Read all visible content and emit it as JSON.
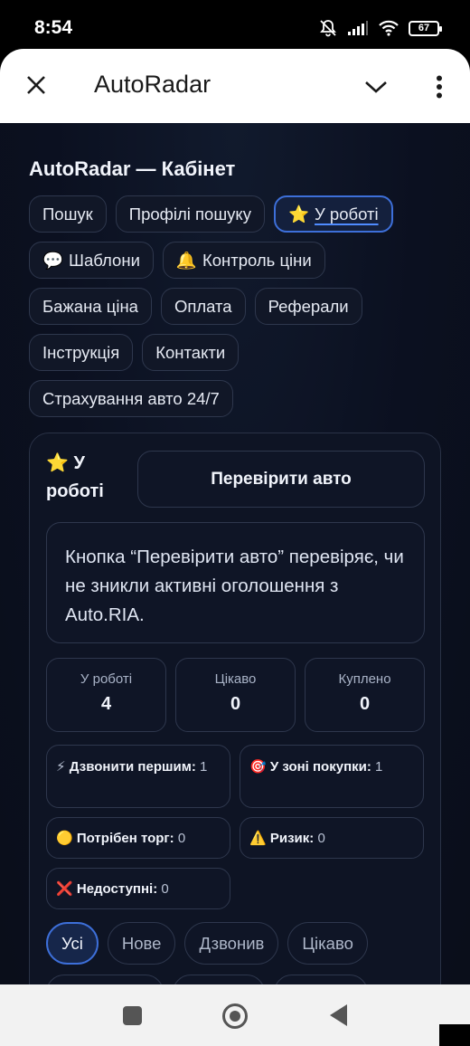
{
  "status_bar": {
    "time": "8:54",
    "battery": "67"
  },
  "app_bar": {
    "title": "AutoRadar"
  },
  "page": {
    "title": "AutoRadar — Кабінет"
  },
  "tabs": [
    {
      "icon": "",
      "label": "Пошук"
    },
    {
      "icon": "",
      "label": "Профілі пошуку"
    },
    {
      "icon": "⭐",
      "label": "У роботі"
    },
    {
      "icon": "💬",
      "label": "Шаблони"
    },
    {
      "icon": "🔔",
      "label": "Контроль ціни"
    },
    {
      "icon": "",
      "label": "Бажана ціна"
    },
    {
      "icon": "",
      "label": "Оплата"
    },
    {
      "icon": "",
      "label": "Реферали"
    },
    {
      "icon": "",
      "label": "Інструкція"
    },
    {
      "icon": "",
      "label": "Контакти"
    },
    {
      "icon": "",
      "label": "Страхування авто 24/7"
    }
  ],
  "card": {
    "heading_icon": "⭐",
    "heading_text": "У роботі",
    "check_button": "Перевірити авто",
    "info_text": "Кнопка “Перевірити авто” перевіряє, чи не зникли активні оголошення з Auto.RIA.",
    "stats": [
      {
        "label": "У роботі",
        "value": "4"
      },
      {
        "label": "Цікаво",
        "value": "0"
      },
      {
        "label": "Куплено",
        "value": "0"
      }
    ],
    "badges": [
      {
        "icon": "⚡",
        "label": "Дзвонити першим:",
        "value": "1"
      },
      {
        "icon": "🎯",
        "label": "У зоні покупки:",
        "value": "1"
      },
      {
        "icon": "🟡",
        "label": "Потрібен торг:",
        "value": "0"
      },
      {
        "icon": "⚠️",
        "label": "Ризик:",
        "value": "0"
      },
      {
        "icon": "❌",
        "label": "Недоступні:",
        "value": "0"
      }
    ],
    "filters": [
      "Усі",
      "Нове",
      "Дзвонив",
      "Цікаво"
    ]
  },
  "colors": {
    "accent": "#3d6fd9",
    "background": "#0b1020",
    "card_border": "#2e374d"
  }
}
